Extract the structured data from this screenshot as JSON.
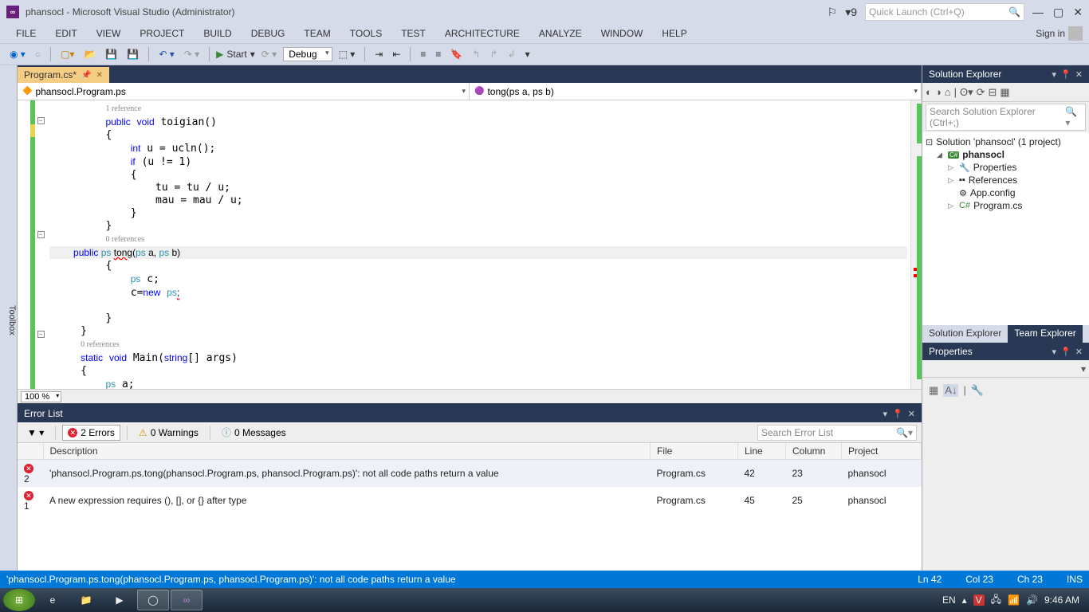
{
  "title": "phansocl - Microsoft Visual Studio (Administrator)",
  "notifications_count": "9",
  "quick_launch_placeholder": "Quick Launch (Ctrl+Q)",
  "menus": [
    "FILE",
    "EDIT",
    "VIEW",
    "PROJECT",
    "BUILD",
    "DEBUG",
    "TEAM",
    "TOOLS",
    "TEST",
    "ARCHITECTURE",
    "ANALYZE",
    "WINDOW",
    "HELP"
  ],
  "signin": "Sign in",
  "toolbar": {
    "start": "Start",
    "config": "Debug"
  },
  "toolbox_label": "Toolbox",
  "doc_tab": "Program.cs*",
  "nav_left": "phansocl.Program.ps",
  "nav_right": "tong(ps a, ps b)",
  "zoom": "100 %",
  "code_refs": {
    "one": "1 reference",
    "zero": "0 references"
  },
  "error_list": {
    "title": "Error List",
    "errors_label": "2 Errors",
    "warnings_label": "0 Warnings",
    "messages_label": "0 Messages",
    "search_placeholder": "Search Error List",
    "cols": {
      "desc": "Description",
      "file": "File",
      "line": "Line",
      "col": "Column",
      "project": "Project"
    },
    "rows": [
      {
        "n": "2",
        "desc": "'phansocl.Program.ps.tong(phansocl.Program.ps, phansocl.Program.ps)': not all code paths return a value",
        "file": "Program.cs",
        "line": "42",
        "col": "23",
        "project": "phansocl"
      },
      {
        "n": "1",
        "desc": "A new expression requires (), [], or {} after type",
        "file": "Program.cs",
        "line": "45",
        "col": "25",
        "project": "phansocl"
      }
    ]
  },
  "solution_explorer": {
    "title": "Solution Explorer",
    "search_placeholder": "Search Solution Explorer (Ctrl+;)",
    "solution": "Solution 'phansocl' (1 project)",
    "project": "phansocl",
    "items": [
      "Properties",
      "References",
      "App.config",
      "Program.cs"
    ],
    "tabs": {
      "se": "Solution Explorer",
      "te": "Team Explorer"
    }
  },
  "properties": {
    "title": "Properties"
  },
  "statusbar": {
    "msg": "'phansocl.Program.ps.tong(phansocl.Program.ps, phansocl.Program.ps)': not all code paths return a value",
    "ln": "Ln 42",
    "col": "Col 23",
    "ch": "Ch 23",
    "ins": "INS"
  },
  "taskbar": {
    "lang": "EN",
    "time": "9:46 AM"
  }
}
